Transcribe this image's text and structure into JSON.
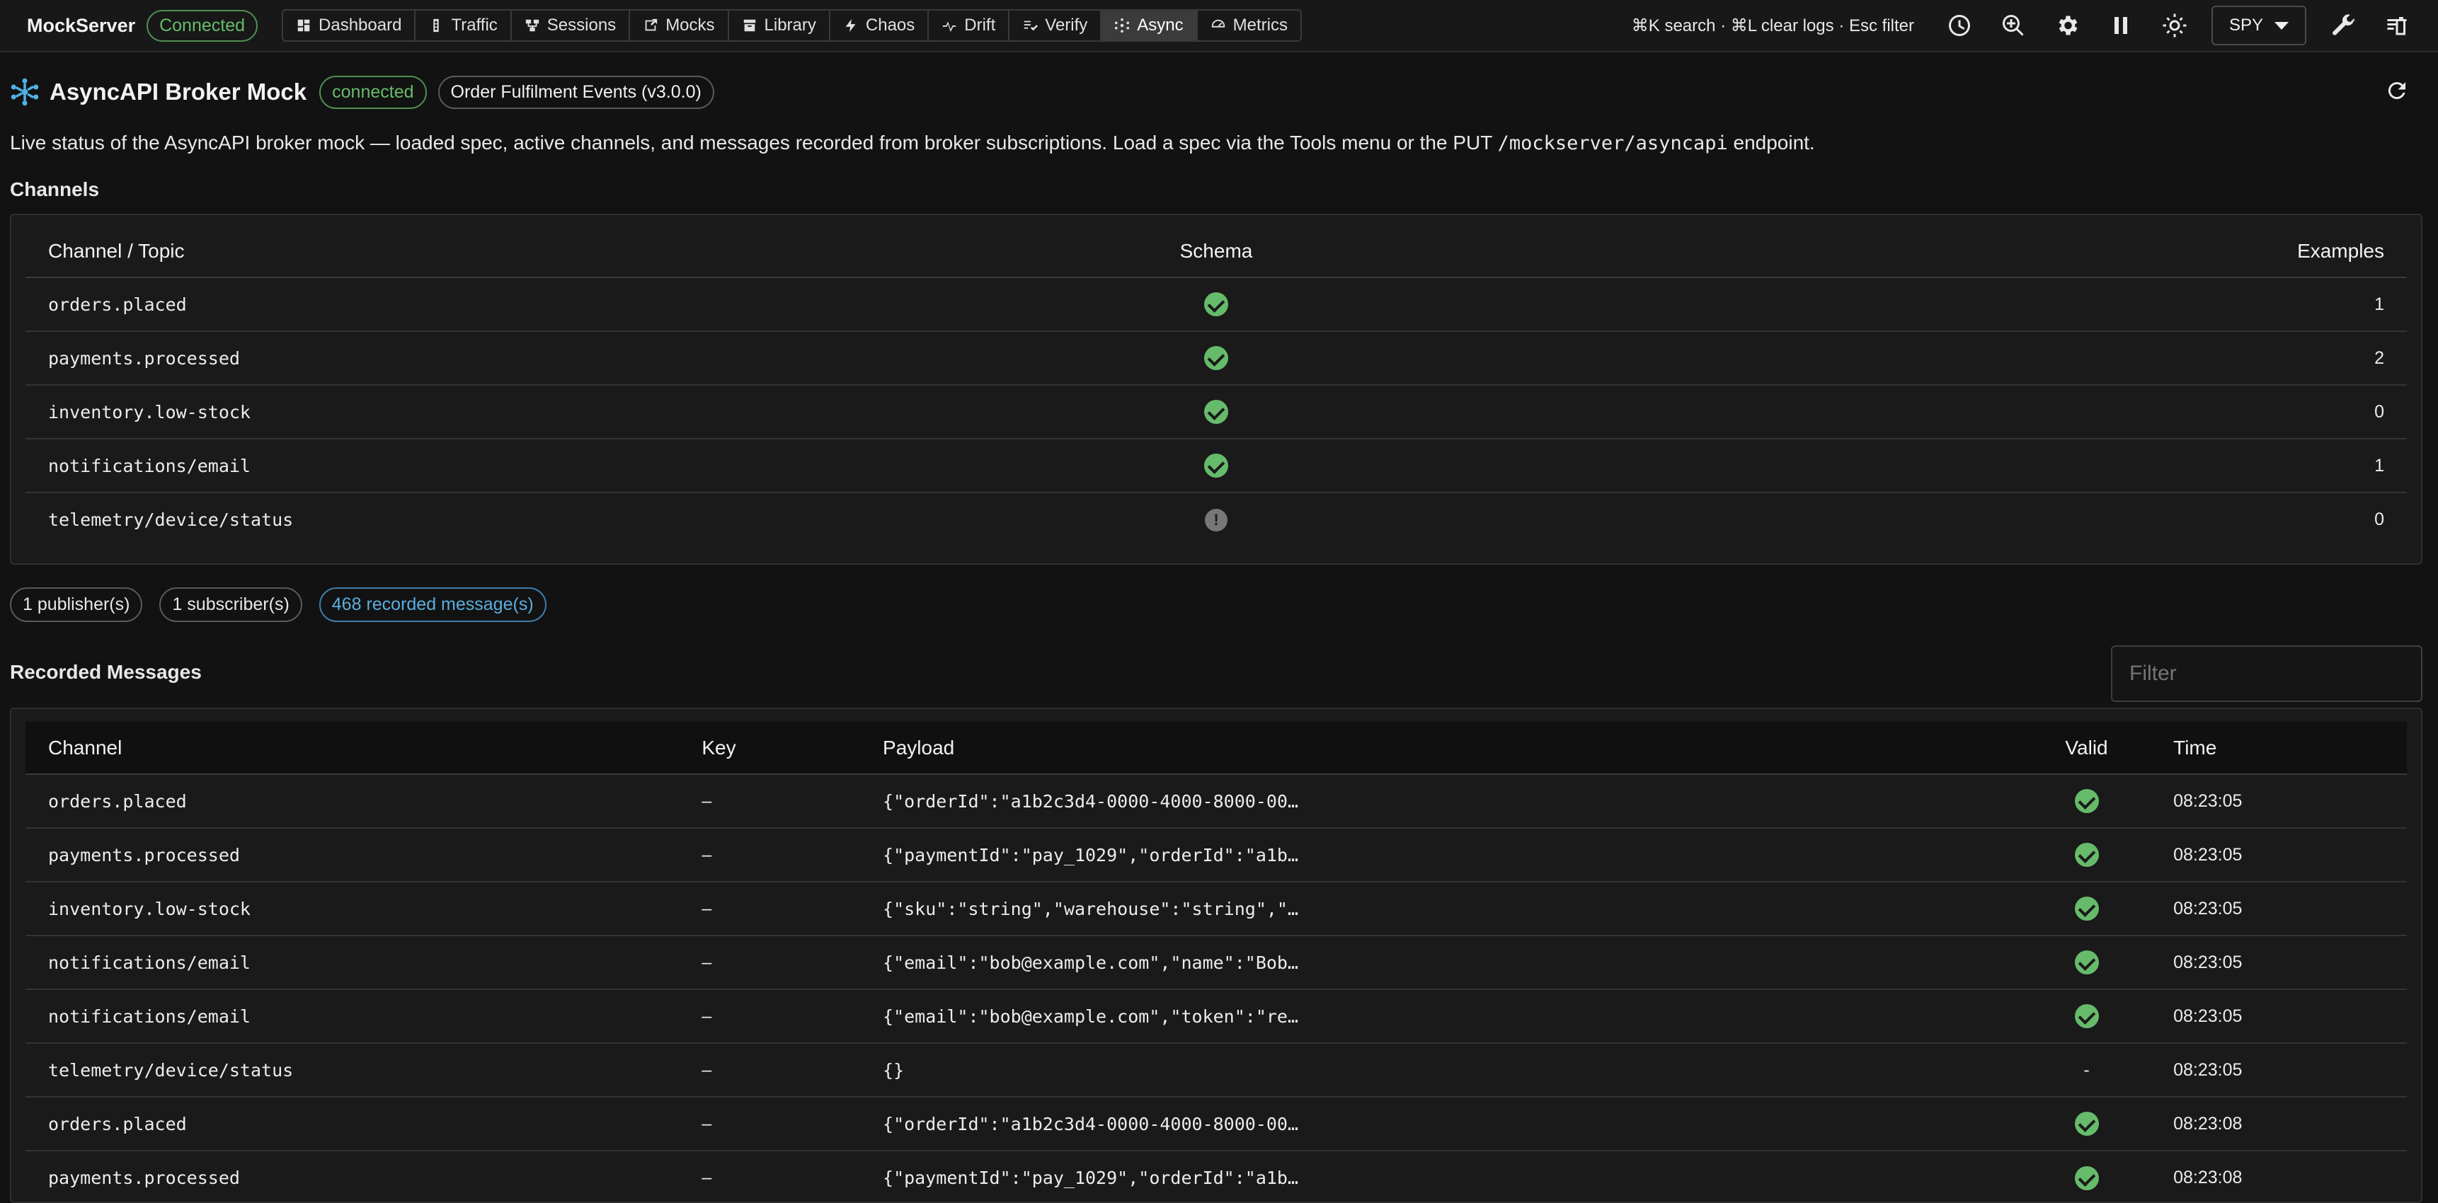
{
  "app": {
    "name": "MockServer",
    "connection": "Connected",
    "nav": [
      {
        "label": "Dashboard",
        "icon": "dashboard-icon"
      },
      {
        "label": "Traffic",
        "icon": "traffic-icon"
      },
      {
        "label": "Sessions",
        "icon": "sessions-icon"
      },
      {
        "label": "Mocks",
        "icon": "mocks-icon"
      },
      {
        "label": "Library",
        "icon": "library-icon"
      },
      {
        "label": "Chaos",
        "icon": "bolt-icon"
      },
      {
        "label": "Drift",
        "icon": "drift-icon"
      },
      {
        "label": "Verify",
        "icon": "verify-icon"
      },
      {
        "label": "Async",
        "icon": "async-icon",
        "active": true
      },
      {
        "label": "Metrics",
        "icon": "gauge-icon"
      }
    ],
    "shortcuts": "⌘K search · ⌘L clear logs · Esc filter",
    "mode": "SPY",
    "toolbar_icons": [
      "history-icon",
      "zoom-search-icon",
      "settings-icon",
      "pause-icon",
      "theme-icon",
      "wrench-icon",
      "clear-icon"
    ]
  },
  "header": {
    "title": "AsyncAPI Broker Mock",
    "status": "connected",
    "spec": "Order Fulfilment Events (v3.0.0)"
  },
  "description": {
    "before": "Live status of the AsyncAPI broker mock — loaded spec, active channels, and messages recorded from broker subscriptions. Load a spec via the Tools menu or the PUT ",
    "code": "/mockserver/asyncapi",
    "after": " endpoint."
  },
  "channels": {
    "title": "Channels",
    "headers": [
      "Channel / Topic",
      "Schema",
      "Examples"
    ],
    "rows": [
      {
        "name": "orders.placed",
        "schema": "valid",
        "examples": "1"
      },
      {
        "name": "payments.processed",
        "schema": "valid",
        "examples": "2"
      },
      {
        "name": "inventory.low-stock",
        "schema": "valid",
        "examples": "0"
      },
      {
        "name": "notifications/email",
        "schema": "valid",
        "examples": "1"
      },
      {
        "name": "telemetry/device/status",
        "schema": "missing",
        "examples": "0"
      }
    ]
  },
  "counts": {
    "publishers": "1 publisher(s)",
    "subscribers": "1 subscriber(s)",
    "recorded": "468 recorded message(s)"
  },
  "messages": {
    "title": "Recorded Messages",
    "filter_placeholder": "Filter",
    "headers": [
      "Channel",
      "Key",
      "Payload",
      "Valid",
      "Time"
    ],
    "rows": [
      {
        "channel": "orders.placed",
        "key": "–",
        "payload": "{\"orderId\":\"a1b2c3d4-0000-4000-8000-00…",
        "valid": "check",
        "time": "08:23:05"
      },
      {
        "channel": "payments.processed",
        "key": "–",
        "payload": "{\"paymentId\":\"pay_1029\",\"orderId\":\"a1b…",
        "valid": "check",
        "time": "08:23:05"
      },
      {
        "channel": "inventory.low-stock",
        "key": "–",
        "payload": "{\"sku\":\"string\",\"warehouse\":\"string\",\"…",
        "valid": "check",
        "time": "08:23:05"
      },
      {
        "channel": "notifications/email",
        "key": "–",
        "payload": "{\"email\":\"bob@example.com\",\"name\":\"Bob…",
        "valid": "check",
        "time": "08:23:05"
      },
      {
        "channel": "notifications/email",
        "key": "–",
        "payload": "{\"email\":\"bob@example.com\",\"token\":\"re…",
        "valid": "check",
        "time": "08:23:05"
      },
      {
        "channel": "telemetry/device/status",
        "key": "–",
        "payload": "{}",
        "valid": "-",
        "time": "08:23:05"
      },
      {
        "channel": "orders.placed",
        "key": "–",
        "payload": "{\"orderId\":\"a1b2c3d4-0000-4000-8000-00…",
        "valid": "check",
        "time": "08:23:08"
      },
      {
        "channel": "payments.processed",
        "key": "–",
        "payload": "{\"paymentId\":\"pay_1029\",\"orderId\":\"a1b…",
        "valid": "check",
        "time": "08:23:08"
      }
    ]
  }
}
